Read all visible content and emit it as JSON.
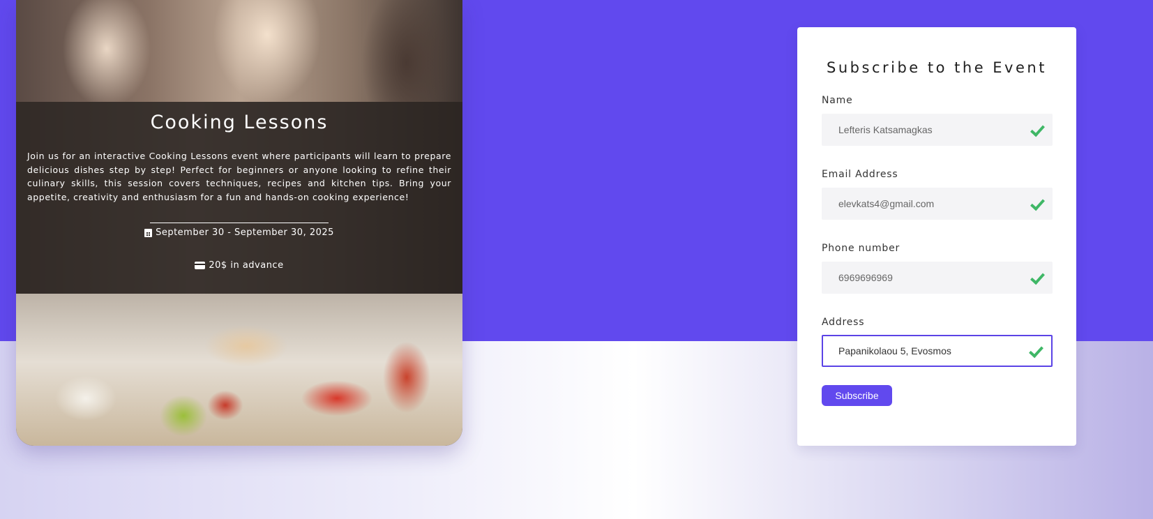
{
  "event": {
    "title": "Cooking Lessons",
    "description": "Join us for an interactive Cooking Lessons event where participants will learn to prepare delicious dishes step by step! Perfect for beginners or anyone looking to refine their culinary skills, this session covers techniques, recipes and kitchen tips. Bring your appetite, creativity and enthusiasm for a fun and hands-on cooking experience!",
    "dates": "September 30 - September 30, 2025",
    "price": "20$ in advance",
    "date_icon": "calendar-icon",
    "price_icon": "credit-card-icon"
  },
  "form": {
    "title": "Subscribe to the Event",
    "fields": [
      {
        "label": "Name",
        "value": "Lefteris Katsamagkas",
        "status_icon": "check-icon"
      },
      {
        "label": "Email Address",
        "value": "elevkats4@gmail.com",
        "status_icon": "check-icon"
      },
      {
        "label": "Phone number",
        "value": "6969696969",
        "status_icon": "check-icon"
      },
      {
        "label": "Address",
        "value": "Papanikolaou 5, Evosmos",
        "status_icon": "check-icon",
        "focused": true
      }
    ],
    "submit_label": "Subscribe"
  },
  "colors": {
    "accent": "#6149ee",
    "valid": "#3fb766",
    "input_bg": "#f4f4f6"
  }
}
